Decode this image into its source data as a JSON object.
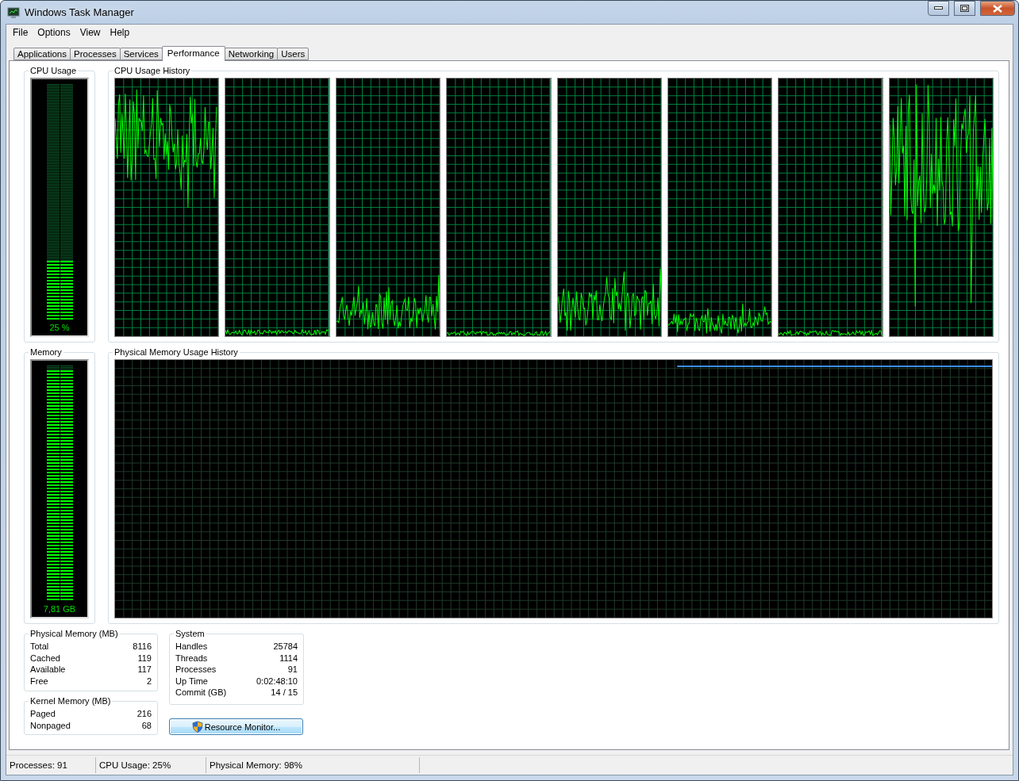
{
  "window": {
    "title": "Windows Task Manager"
  },
  "menu": [
    "File",
    "Options",
    "View",
    "Help"
  ],
  "tabs": [
    {
      "label": "Applications",
      "selected": false
    },
    {
      "label": "Processes",
      "selected": false
    },
    {
      "label": "Services",
      "selected": false
    },
    {
      "label": "Performance",
      "selected": true
    },
    {
      "label": "Networking",
      "selected": false
    },
    {
      "label": "Users",
      "selected": false
    }
  ],
  "cpu_usage": {
    "title": "CPU Usage",
    "level": 0.25,
    "reading": "25 %"
  },
  "cpu_history": {
    "title": "CPU Usage History"
  },
  "memory": {
    "title": "Memory",
    "level": 0.98,
    "reading": "7,81 GB"
  },
  "memory_history": {
    "title": "Physical Memory Usage History"
  },
  "physical_memory": {
    "title": "Physical Memory (MB)",
    "rows": [
      {
        "label": "Total",
        "value": "8116"
      },
      {
        "label": "Cached",
        "value": "119"
      },
      {
        "label": "Available",
        "value": "117"
      },
      {
        "label": "Free",
        "value": "2"
      }
    ]
  },
  "kernel_memory": {
    "title": "Kernel Memory (MB)",
    "rows": [
      {
        "label": "Paged",
        "value": "216"
      },
      {
        "label": "Nonpaged",
        "value": "68"
      }
    ]
  },
  "system": {
    "title": "System",
    "rows": [
      {
        "label": "Handles",
        "value": "25784"
      },
      {
        "label": "Threads",
        "value": "1114"
      },
      {
        "label": "Processes",
        "value": "91"
      },
      {
        "label": "Up Time",
        "value": "0:02:48:10"
      },
      {
        "label": "Commit (GB)",
        "value": "14 / 15"
      }
    ]
  },
  "resource_monitor_button": "Resource Monitor...",
  "status_bar": [
    "Processes: 91",
    "CPU Usage: 25%",
    "Physical Memory: 98%"
  ]
}
